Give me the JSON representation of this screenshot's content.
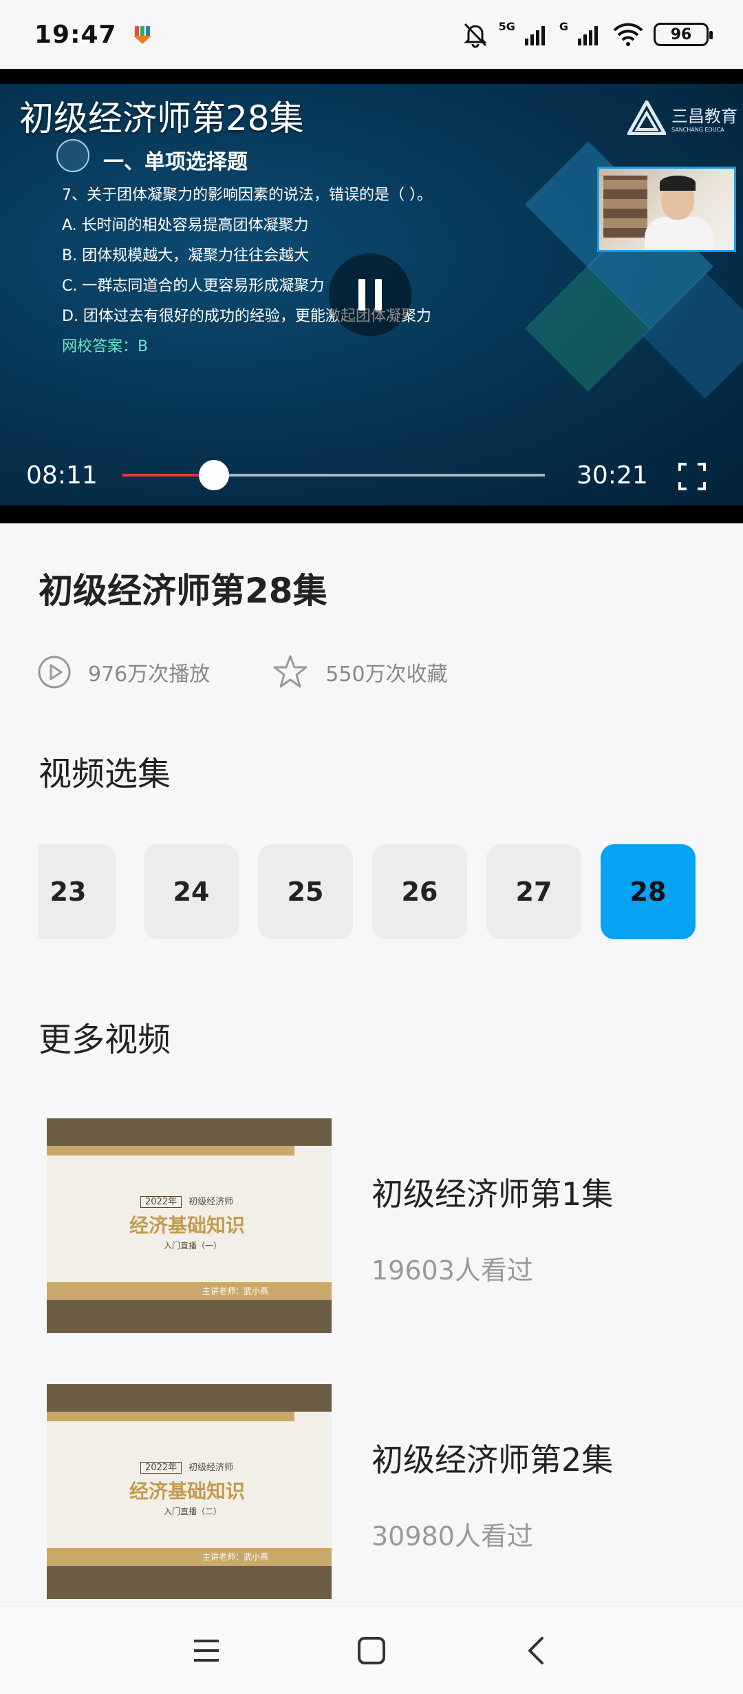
{
  "status_bar": {
    "time": "19:47",
    "net_5g": "5G",
    "net_g": "G",
    "battery": "96"
  },
  "player": {
    "title": "初级经济师第28集",
    "logo_text": "三昌教育",
    "logo_sub": "SANCHANG EDUCA",
    "slide": {
      "section": "一、单项选择题",
      "lines": [
        "7、关于团体凝聚力的影响因素的说法，错误的是（     ）。",
        "A. 长时间的相处容易提高团体凝聚力",
        "B. 团体规模越大，凝聚力往往会越大",
        "C. 一群志同道合的人更容易形成凝聚力",
        "D. 团体过去有很好的成功的经验，更能激起团体凝聚力"
      ],
      "answer": "网校答案：B"
    },
    "current_time": "08:11",
    "duration": "30:21",
    "progress": 0.217
  },
  "info": {
    "title": "初级经济师第28集",
    "plays": "976万次播放",
    "favorites": "550万次收藏"
  },
  "episodes": {
    "heading": "视频选集",
    "items": [
      "23",
      "24",
      "25",
      "26",
      "27",
      "28"
    ],
    "active": "28"
  },
  "more": {
    "heading": "更多视频",
    "items": [
      {
        "title": "初级经济师第1集",
        "views": "19603人看过",
        "thumb_year": "2022年",
        "thumb_cat": "初级经济师",
        "thumb_main": "经济基础知识",
        "thumb_sub": "入门直播（一）",
        "thumb_teacher": "主讲老师：武小燕"
      },
      {
        "title": "初级经济师第2集",
        "views": "30980人看过",
        "thumb_year": "2022年",
        "thumb_cat": "初级经济师",
        "thumb_main": "经济基础知识",
        "thumb_sub": "入门直播（二）",
        "thumb_teacher": "主讲老师：武小燕"
      }
    ]
  },
  "colors": {
    "accent": "#06a2f4",
    "progress": "#e23b3b"
  }
}
